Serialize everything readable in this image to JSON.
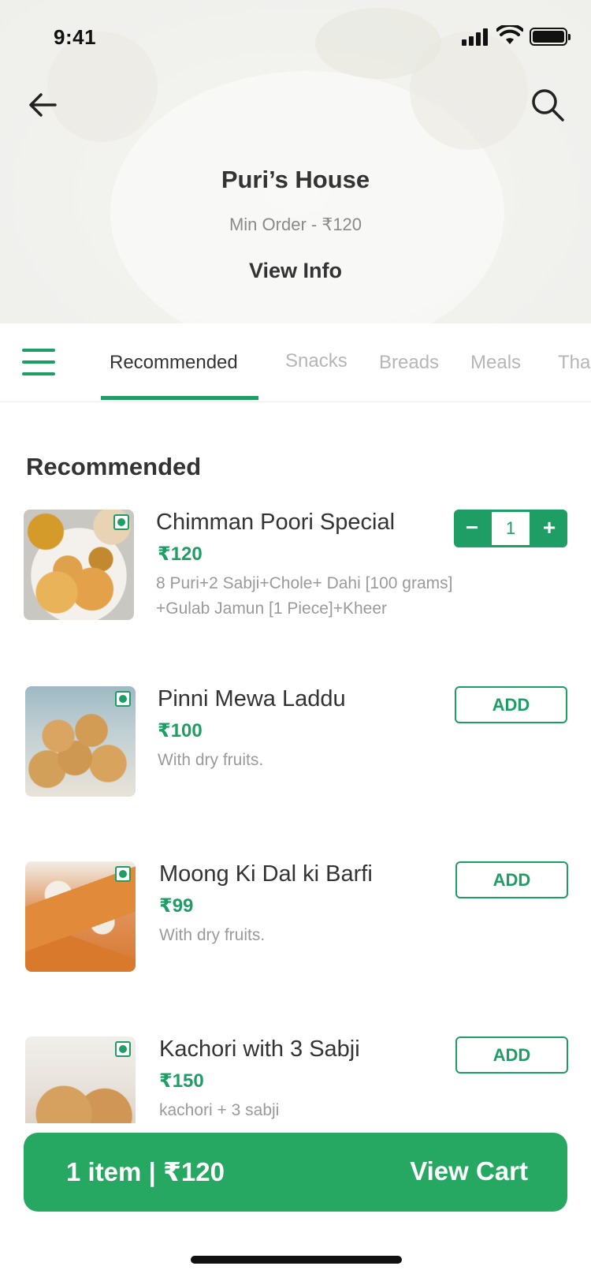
{
  "status": {
    "time": "9:41"
  },
  "store": {
    "name": "Puri’s House",
    "min_order": "Min Order - ₹120",
    "view_info": "View Info"
  },
  "tabs": [
    {
      "label": "Recommended",
      "active": true
    },
    {
      "label": "Snacks",
      "active": false
    },
    {
      "label": "Breads",
      "active": false
    },
    {
      "label": "Meals",
      "active": false
    },
    {
      "label": "Tha",
      "active": false
    }
  ],
  "section": {
    "title": "Recommended"
  },
  "items": [
    {
      "name": "Chimman Poori Special",
      "price": "₹120",
      "description": "8 Puri+2 Sabji+Chole+ Dahi [100 grams] +Gulab Jamun [1 Piece]+Kheer",
      "quantity": "1",
      "minus_label": "−",
      "plus_label": "+"
    },
    {
      "name": "Pinni Mewa Laddu",
      "price": "₹100",
      "description": "With dry fruits.",
      "button_label": "ADD"
    },
    {
      "name": "Moong Ki Dal ki Barfi",
      "price": "₹99",
      "description": "With dry fruits.",
      "button_label": "ADD"
    },
    {
      "name": "Kachori with 3 Sabji",
      "price": "₹150",
      "description": "kachori + 3 sabji",
      "button_label": "ADD"
    }
  ],
  "cart": {
    "summary": "1 item | ₹120",
    "action": "View Cart"
  },
  "colors": {
    "accent": "#1e9e64",
    "cart_bar": "#26a862"
  },
  "icons": {
    "back": "back-arrow-icon",
    "search": "search-icon",
    "menu": "hamburger-menu-icon",
    "veg": "veg-indicator-icon"
  }
}
